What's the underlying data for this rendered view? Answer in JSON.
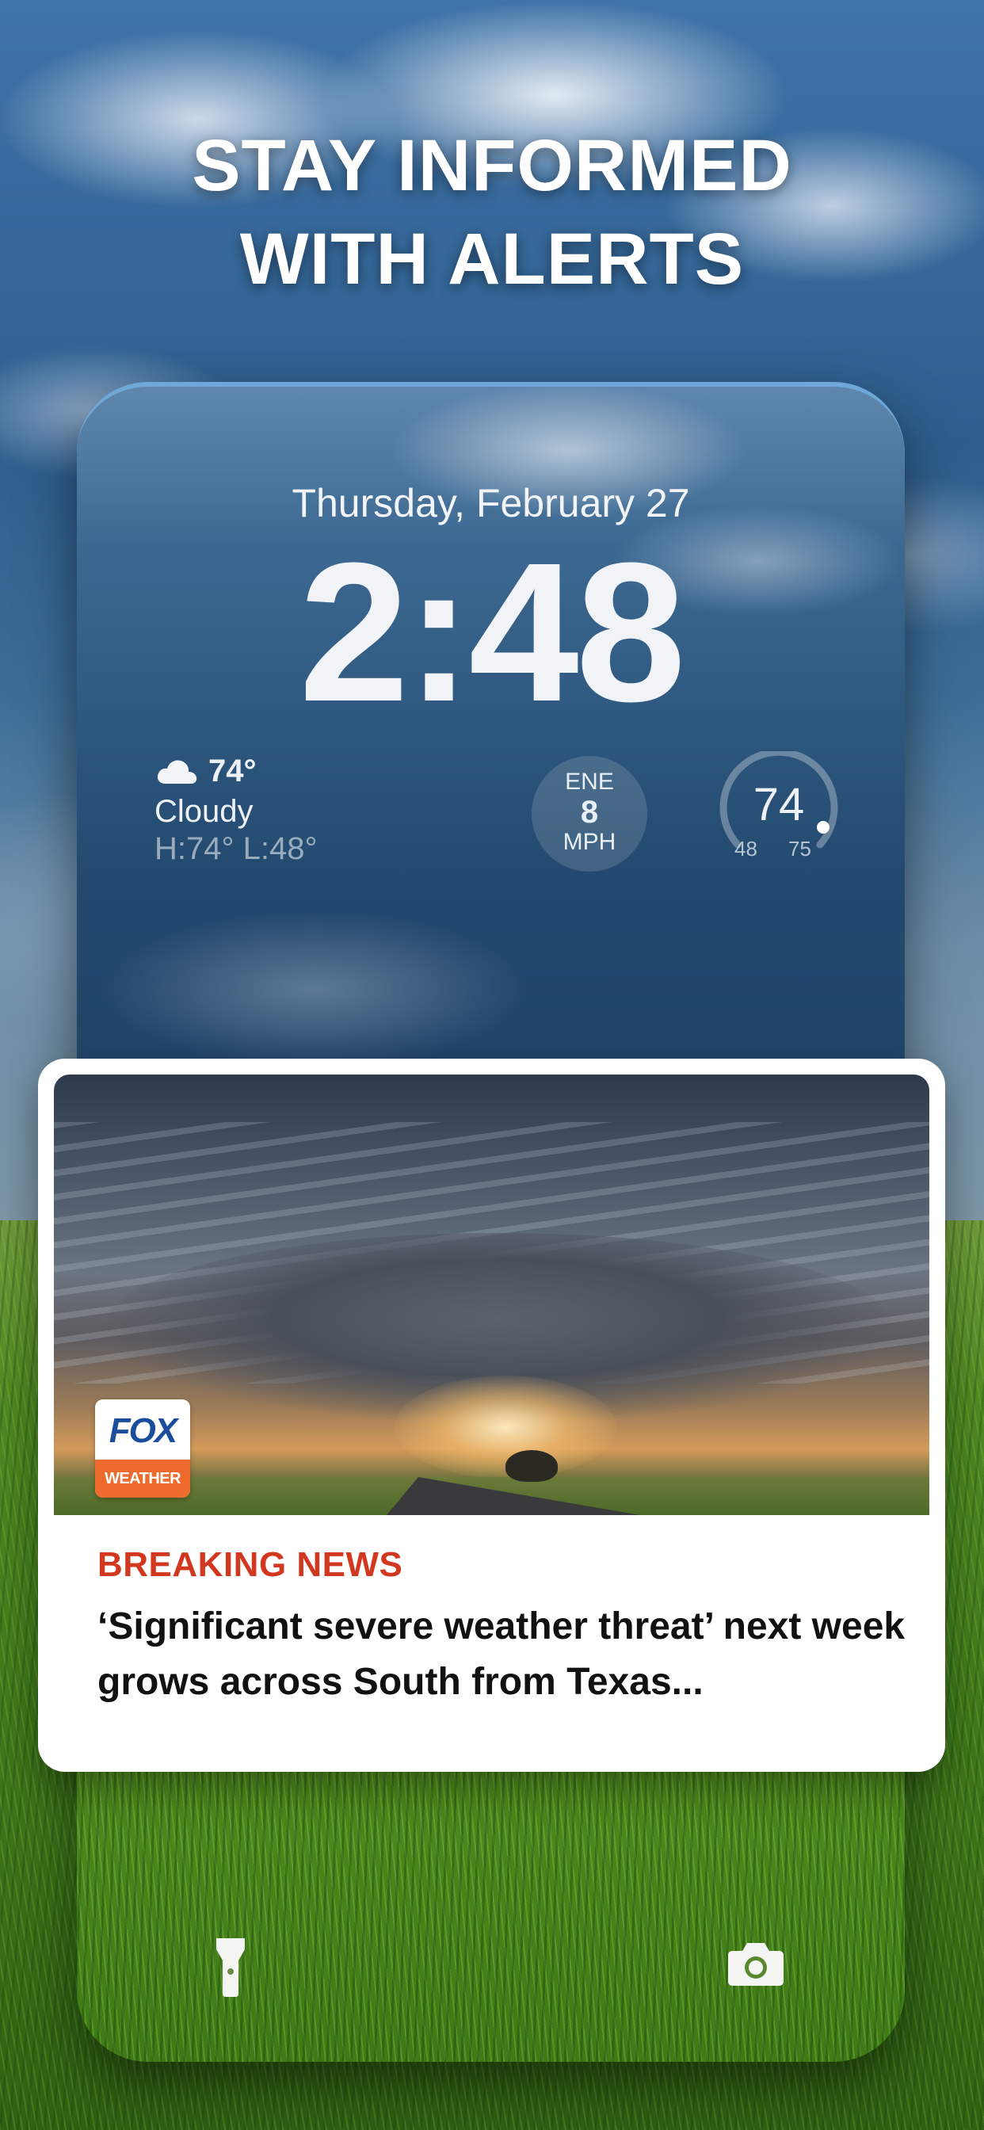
{
  "headline": {
    "line1": "STAY INFORMED",
    "line2": "WITH ALERTS"
  },
  "lock_screen": {
    "date": "Thursday, February 27",
    "time": "2:48",
    "weather": {
      "icon": "cloud-icon",
      "temp": "74°",
      "condition": "Cloudy",
      "high_low": "H:74° L:48°"
    },
    "wind": {
      "direction": "ENE",
      "speed": "8",
      "unit": "MPH"
    },
    "temp_gauge": {
      "current": "74",
      "low": "48",
      "high": "75"
    },
    "icons": {
      "left": "flashlight-icon",
      "right": "camera-icon"
    }
  },
  "notification": {
    "logo": {
      "top": "FOX",
      "bottom": "WEATHER"
    },
    "label": "BREAKING NEWS",
    "title": "‘Significant severe weather threat’ next week grows across South from Texas..."
  },
  "colors": {
    "breaking_red": "#d1381f",
    "fox_blue": "#1a4d9c",
    "fox_orange": "#ee6b2d"
  }
}
